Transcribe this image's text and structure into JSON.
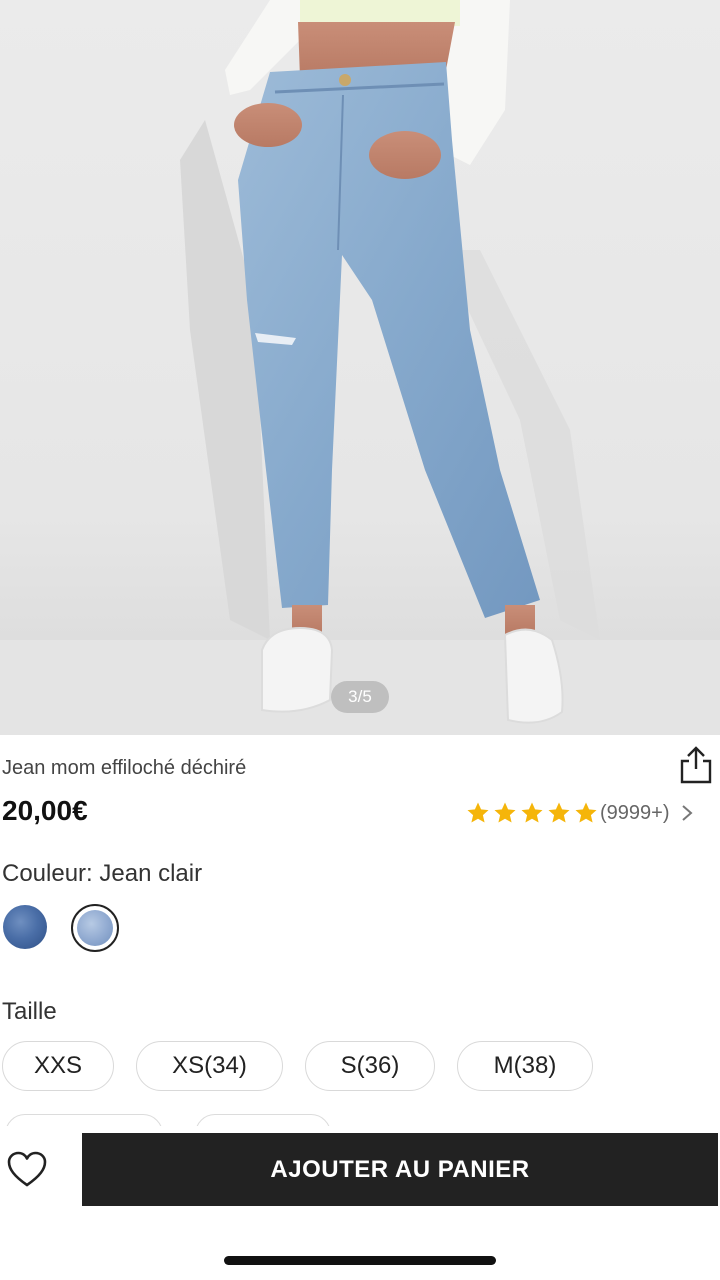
{
  "gallery": {
    "counter": "3/5",
    "image_icon": "product-photo-jeans"
  },
  "product": {
    "title": "Jean mom effiloché déchiré",
    "price": "20,00€",
    "rating": {
      "stars": 5,
      "count": "(9999+)",
      "star_color": "#f5b50a"
    },
    "share_icon": "share-icon"
  },
  "color": {
    "label": "Couleur: Jean clair",
    "swatches": [
      {
        "name": "Jean foncé swatch",
        "selected": false,
        "color": "#4a6ea7"
      },
      {
        "name": "Jean clair swatch",
        "selected": true,
        "color": "#93acd2"
      }
    ]
  },
  "size": {
    "label": "Taille",
    "options": [
      "XXS",
      "XS(34)",
      "S(36)",
      "M(38)"
    ]
  },
  "actions": {
    "wishlist_icon": "heart-icon",
    "add_to_cart": "AJOUTER AU PANIER",
    "button_color": "#222222"
  }
}
